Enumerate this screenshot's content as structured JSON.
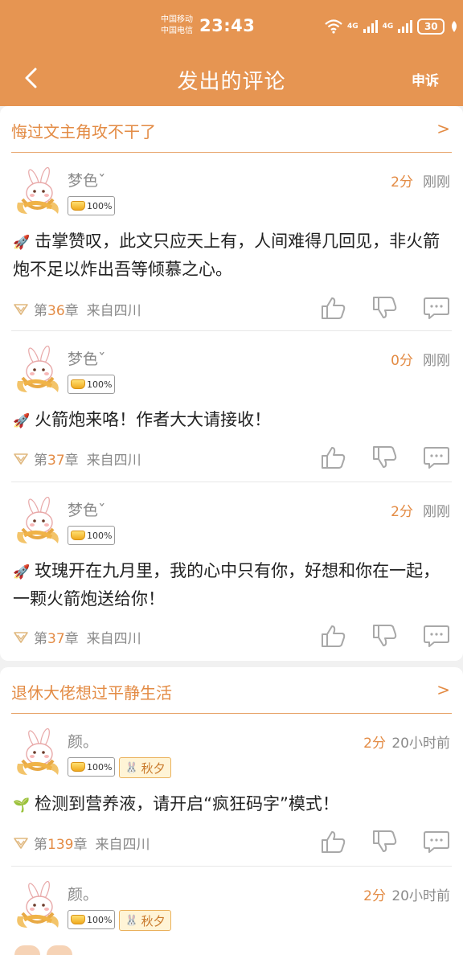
{
  "status_bar": {
    "carrier1": "中国移动",
    "carrier2": "中国电信",
    "time": "23:43",
    "net1": "4G",
    "net2": "4G",
    "battery": "30"
  },
  "nav": {
    "title": "发出的评论",
    "action": "申诉"
  },
  "colors": {
    "accent": "#e69552",
    "orange_text": "#e38b44",
    "grey_text": "#8a8a8a"
  },
  "groups": [
    {
      "book_title": "悔过文主角攻不干了",
      "arrow": ">",
      "comments": [
        {
          "user": "梦色ˇ",
          "score": "2分",
          "time": "刚刚",
          "badge": "100%",
          "tag": null,
          "emoji_icon": "rocket-icon",
          "emoji": "🚀",
          "text": "击掌赞叹，此文只应天上有，人间难得几回见，非火箭炮不足以炸出吾等倾慕之心。",
          "chapter_prefix": "第",
          "chapter": "36",
          "chapter_suffix": "章",
          "region": "来自四川"
        },
        {
          "user": "梦色ˇ",
          "score": "0分",
          "time": "刚刚",
          "badge": "100%",
          "tag": null,
          "emoji_icon": "rocket-icon",
          "emoji": "🚀",
          "text": "火箭炮来咯！作者大大请接收！",
          "chapter_prefix": "第",
          "chapter": "37",
          "chapter_suffix": "章",
          "region": "来自四川"
        },
        {
          "user": "梦色ˇ",
          "score": "2分",
          "time": "刚刚",
          "badge": "100%",
          "tag": null,
          "emoji_icon": "rocket-icon",
          "emoji": "🚀",
          "text": "玫瑰开在九月里，我的心中只有你，好想和你在一起，一颗火箭炮送给你！",
          "chapter_prefix": "第",
          "chapter": "37",
          "chapter_suffix": "章",
          "region": "来自四川"
        }
      ]
    },
    {
      "book_title": "退休大佬想过平静生活",
      "arrow": ">",
      "comments": [
        {
          "user": "颜。",
          "score": "2分",
          "time": "20小时前",
          "badge": "100%",
          "tag": "秋夕",
          "emoji_icon": "sprout-icon",
          "emoji": "🌱",
          "text": "检测到营养液，请开启“疯狂码字”模式！",
          "chapter_prefix": "第",
          "chapter": "139",
          "chapter_suffix": "章",
          "region": "来自四川"
        },
        {
          "user": "颜。",
          "score": "2分",
          "time": "20小时前",
          "badge": "100%",
          "tag": "秋夕"
        }
      ]
    }
  ]
}
